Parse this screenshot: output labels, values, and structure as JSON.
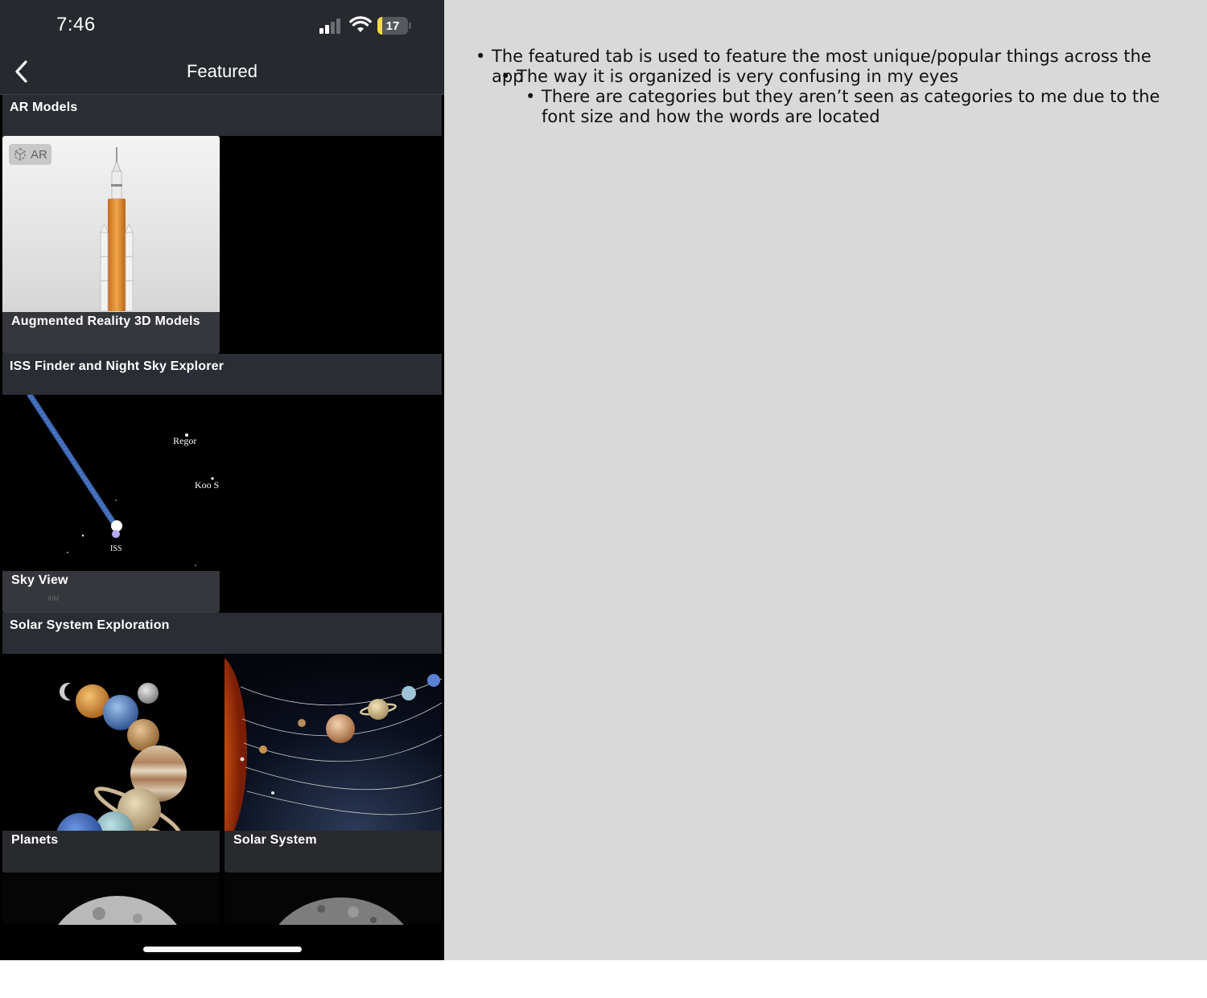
{
  "status_bar": {
    "time": "7:46",
    "battery_level": "17",
    "signal_icon": "cellular-signal-icon",
    "wifi_icon": "wifi-icon",
    "battery_icon": "battery-icon"
  },
  "nav": {
    "title": "Featured",
    "back_icon": "chevron-left-icon"
  },
  "sections": [
    {
      "title": "AR Models",
      "cards": [
        {
          "label": "Augmented Reality 3D Models",
          "badge": "AR",
          "image": "rocket-image"
        }
      ]
    },
    {
      "title": "ISS Finder and Night Sky Explorer",
      "cards": [
        {
          "label": "Sky View",
          "image": "sky-map-image",
          "sky_labels": [
            "Regor",
            "Koo S",
            "ISS",
            "AIM"
          ]
        }
      ]
    },
    {
      "title": "Solar System Exploration",
      "cards": [
        {
          "label": "Planets",
          "image": "planets-image"
        },
        {
          "label": "Solar System",
          "image": "solar-system-image"
        }
      ]
    }
  ],
  "notes": [
    "The featured tab is used to feature the most unique/popular things across the app",
    "The way it is organized is very confusing in my eyes",
    "There are categories but they aren’t seen as categories to me due to the font size and how the words are located"
  ],
  "colors": {
    "bar_background": "#26292e",
    "section_header": "#2a2d33",
    "notes_background": "#d9d9d9",
    "battery_accent": "#f6d94a"
  }
}
